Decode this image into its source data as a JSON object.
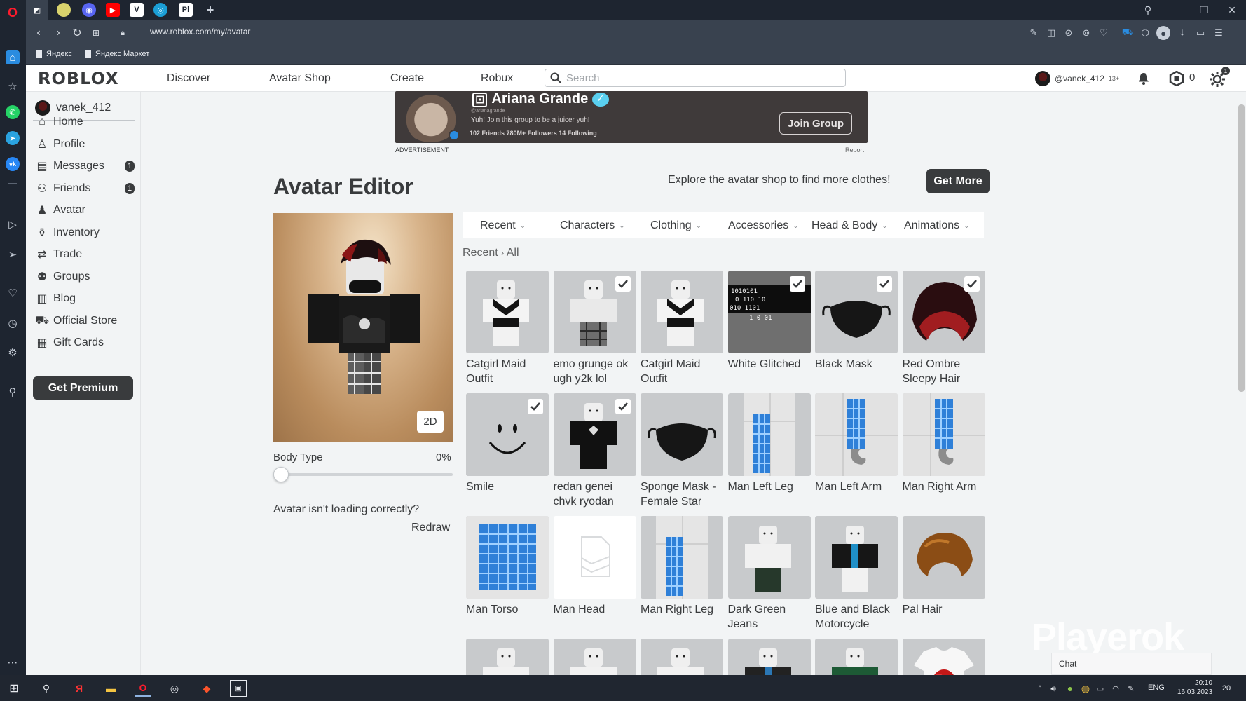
{
  "browser": {
    "url": "www.roblox.com/my/avatar",
    "bookmarks": [
      "Яндекс",
      "Яндекс Маркет"
    ],
    "tab_letters": [
      "",
      "",
      "",
      "",
      "",
      "",
      "Pl"
    ],
    "new_tab": "+"
  },
  "header": {
    "logo": "ROBLOX",
    "nav": [
      "Discover",
      "Avatar Shop",
      "Create",
      "Robux"
    ],
    "search_placeholder": "Search",
    "username": "@vanek_412",
    "age_badge": "13+",
    "robux_count": "0",
    "settings_badge": "1"
  },
  "sidebar": {
    "username": "vanek_412",
    "items": [
      {
        "label": "Home",
        "icon": "home-icon"
      },
      {
        "label": "Profile",
        "icon": "profile-icon"
      },
      {
        "label": "Messages",
        "icon": "messages-icon",
        "badge": "1"
      },
      {
        "label": "Friends",
        "icon": "friends-icon",
        "badge": "1"
      },
      {
        "label": "Avatar",
        "icon": "avatar-icon"
      },
      {
        "label": "Inventory",
        "icon": "inventory-icon"
      },
      {
        "label": "Trade",
        "icon": "trade-icon"
      },
      {
        "label": "Groups",
        "icon": "groups-icon"
      },
      {
        "label": "Blog",
        "icon": "blog-icon"
      },
      {
        "label": "Official Store",
        "icon": "store-icon"
      },
      {
        "label": "Gift Cards",
        "icon": "gift-cards-icon"
      }
    ],
    "premium_button": "Get Premium"
  },
  "ad": {
    "title": "Ariana Grande",
    "handle": "@arianagrande",
    "description": "Yuh! Join this group to be a juicer yuh!",
    "stats": "102 Friends   780M+ Followers   14 Following",
    "button": "Join Group",
    "label": "ADVERTISEMENT",
    "report": "Report"
  },
  "editor": {
    "title": "Avatar Editor",
    "explore_text": "Explore the avatar shop to find more clothes!",
    "get_more": "Get More",
    "view_toggle": "2D",
    "body_type_label": "Body Type",
    "body_type_value": "0%",
    "body_type_fraction": 0.0,
    "avatar_issue": "Avatar isn't loading correctly?",
    "redraw": "Redraw",
    "tabs": [
      "Recent",
      "Characters",
      "Clothing",
      "Accessories",
      "Head & Body",
      "Animations"
    ],
    "breadcrumb": [
      "Recent",
      "All"
    ],
    "items": [
      {
        "name": "Catgirl Maid Outfit",
        "checked": false,
        "kind": "outfit-maid"
      },
      {
        "name": "emo grunge ok ugh y2k lol",
        "checked": true,
        "kind": "outfit-emo"
      },
      {
        "name": "Catgirl Maid Outfit",
        "checked": false,
        "kind": "outfit-maid"
      },
      {
        "name": "White Glitched",
        "checked": true,
        "kind": "glitched"
      },
      {
        "name": "Black Mask",
        "checked": true,
        "kind": "mask"
      },
      {
        "name": "Red Ombre Sleepy Hair",
        "checked": true,
        "kind": "hair-red"
      },
      {
        "name": "Smile",
        "checked": true,
        "kind": "smile"
      },
      {
        "name": "redan genei chvk ryodan",
        "checked": true,
        "kind": "shirt-black"
      },
      {
        "name": "Sponge Mask - Female Star",
        "checked": false,
        "kind": "mask"
      },
      {
        "name": "Man Left Leg",
        "checked": false,
        "kind": "leg"
      },
      {
        "name": "Man Left Arm",
        "checked": false,
        "kind": "arm"
      },
      {
        "name": "Man Right Arm",
        "checked": false,
        "kind": "arm"
      },
      {
        "name": "Man Torso",
        "checked": false,
        "kind": "torso"
      },
      {
        "name": "Man Head",
        "checked": false,
        "kind": "placeholder"
      },
      {
        "name": "Man Right Leg",
        "checked": false,
        "kind": "leg"
      },
      {
        "name": "Dark Green Jeans",
        "checked": false,
        "kind": "outfit-jeans"
      },
      {
        "name": "Blue and Black Motorcycle",
        "checked": false,
        "kind": "outfit-moto"
      },
      {
        "name": "Pal Hair",
        "checked": false,
        "kind": "hair-brown"
      },
      {
        "name": "",
        "checked": false,
        "kind": "outfit-plain"
      },
      {
        "name": "",
        "checked": false,
        "kind": "outfit-plain"
      },
      {
        "name": "",
        "checked": false,
        "kind": "outfit-plain"
      },
      {
        "name": "",
        "checked": false,
        "kind": "outfit-dark"
      },
      {
        "name": "",
        "checked": false,
        "kind": "outfit-green"
      },
      {
        "name": "",
        "checked": false,
        "kind": "tshirt"
      }
    ]
  },
  "overlay": {
    "watermark": "Playerok",
    "chat": "Chat"
  },
  "taskbar": {
    "language": "ENG",
    "time": "20:10",
    "date": "16.03.2023",
    "notifications": "20"
  },
  "colors": {
    "accent_dark": "#393b3d",
    "page_bg": "#f2f4f5",
    "thumb_bg": "#c8cacc",
    "opera_red": "#ff1b2d"
  }
}
